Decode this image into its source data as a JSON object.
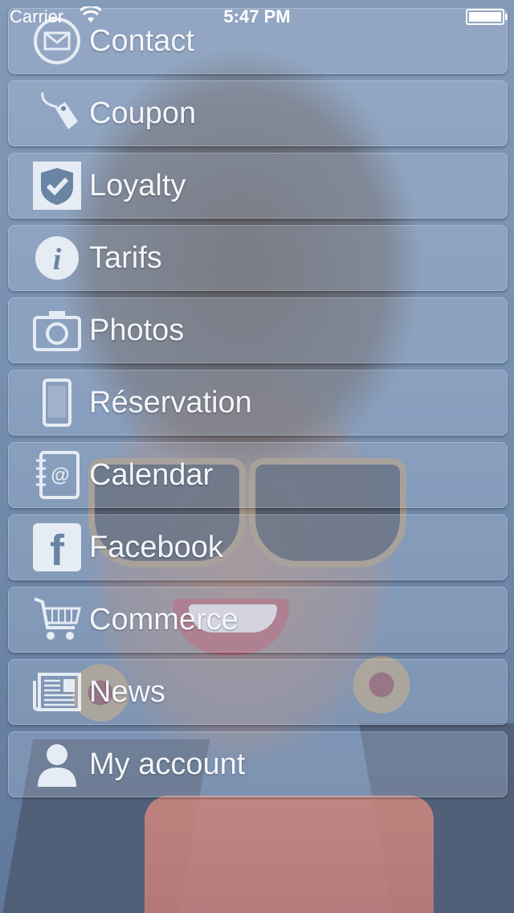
{
  "status_bar": {
    "carrier": "Carrier",
    "time": "5:47 PM"
  },
  "menu": {
    "items": [
      {
        "label": "Contact",
        "icon": "envelope-icon"
      },
      {
        "label": "Coupon",
        "icon": "tag-icon"
      },
      {
        "label": "Loyalty",
        "icon": "shield-check-icon"
      },
      {
        "label": "Tarifs",
        "icon": "info-icon"
      },
      {
        "label": "Photos",
        "icon": "camera-icon"
      },
      {
        "label": "Réservation",
        "icon": "phone-icon"
      },
      {
        "label": "Calendar",
        "icon": "address-book-icon"
      },
      {
        "label": "Facebook",
        "icon": "facebook-icon"
      },
      {
        "label": "Commerce",
        "icon": "cart-icon"
      },
      {
        "label": "News",
        "icon": "newspaper-icon"
      },
      {
        "label": "My account",
        "icon": "user-icon"
      }
    ]
  }
}
